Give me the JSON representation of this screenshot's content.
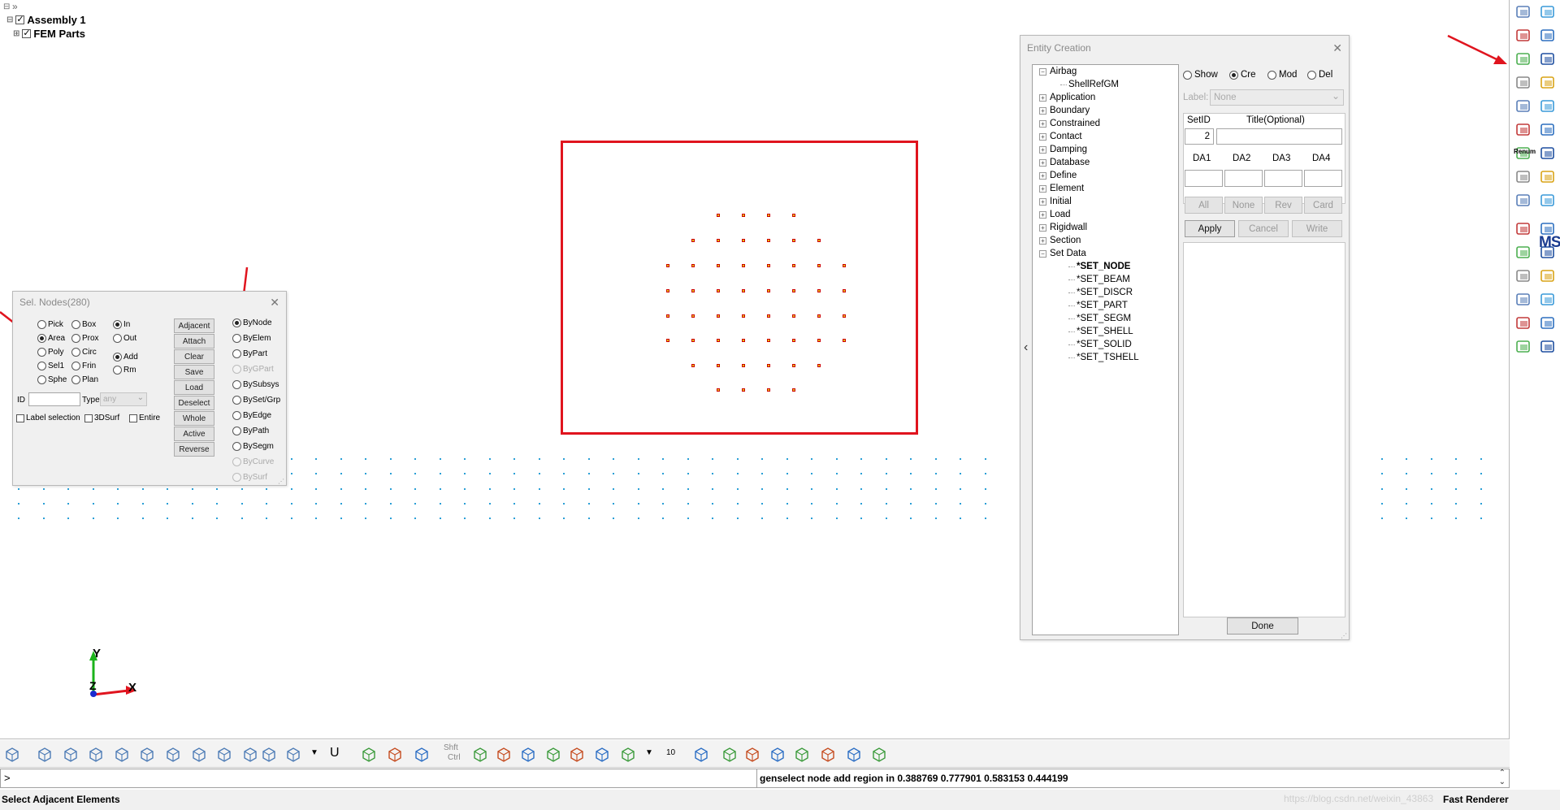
{
  "model_tree": {
    "root_label": "Assembly 1",
    "child_label": "FEM Parts",
    "collapse_glyph": "»"
  },
  "axes": {
    "y_label": "Y",
    "x_label": "X",
    "z_label": "Z"
  },
  "sel_nodes": {
    "title": "Sel. Nodes(280)",
    "pick_modes": [
      {
        "label": "Pick",
        "selected": false
      },
      {
        "label": "Box",
        "selected": false
      },
      {
        "label": "Area",
        "selected": true
      },
      {
        "label": "Prox",
        "selected": false
      },
      {
        "label": "Poly",
        "selected": false
      },
      {
        "label": "Circ",
        "selected": false
      },
      {
        "label": "Sel1",
        "selected": false
      },
      {
        "label": "Frin",
        "selected": false
      },
      {
        "label": "Sphe",
        "selected": false
      },
      {
        "label": "Plan",
        "selected": false
      }
    ],
    "in_label": "In",
    "out_label": "Out",
    "add_label": "Add",
    "rm_label": "Rm",
    "id_label": "ID",
    "type_label": "Type",
    "type_value": "any",
    "label_selection": "Label selection",
    "surf3d": "3DSurf",
    "entire": "Entire",
    "buttons": [
      "Adjacent",
      "Attach",
      "Clear",
      "Save",
      "Load",
      "Deselect",
      "Whole",
      "Active",
      "Reverse"
    ],
    "by_options": [
      {
        "label": "ByNode",
        "selected": true,
        "disabled": false
      },
      {
        "label": "ByElem",
        "selected": false,
        "disabled": false
      },
      {
        "label": "ByPart",
        "selected": false,
        "disabled": false
      },
      {
        "label": "ByGPart",
        "selected": false,
        "disabled": true
      },
      {
        "label": "BySubsys",
        "selected": false,
        "disabled": false
      },
      {
        "label": "BySet/Grp",
        "selected": false,
        "disabled": false
      },
      {
        "label": "ByEdge",
        "selected": false,
        "disabled": false
      },
      {
        "label": "ByPath",
        "selected": false,
        "disabled": false
      },
      {
        "label": "BySegm",
        "selected": false,
        "disabled": false
      },
      {
        "label": "ByCurve",
        "selected": false,
        "disabled": true
      },
      {
        "label": "BySurf",
        "selected": false,
        "disabled": true
      }
    ]
  },
  "entity_creation": {
    "title": "Entity Creation",
    "tree": [
      {
        "label": "Airbag",
        "expanded": true,
        "level": 0
      },
      {
        "label": "ShellRefGM",
        "level": 1
      },
      {
        "label": "Application",
        "level": 0
      },
      {
        "label": "Boundary",
        "level": 0
      },
      {
        "label": "Constrained",
        "level": 0
      },
      {
        "label": "Contact",
        "level": 0
      },
      {
        "label": "Damping",
        "level": 0
      },
      {
        "label": "Database",
        "level": 0
      },
      {
        "label": "Define",
        "level": 0
      },
      {
        "label": "Element",
        "level": 0
      },
      {
        "label": "Initial",
        "level": 0
      },
      {
        "label": "Load",
        "level": 0
      },
      {
        "label": "Rigidwall",
        "level": 0
      },
      {
        "label": "Section",
        "level": 0
      },
      {
        "label": "Set Data",
        "expanded": true,
        "level": 0
      },
      {
        "label": "*SET_NODE",
        "level": 2,
        "bold": true
      },
      {
        "label": "*SET_BEAM",
        "level": 2
      },
      {
        "label": "*SET_DISCR",
        "level": 2
      },
      {
        "label": "*SET_PART",
        "level": 2
      },
      {
        "label": "*SET_SEGM",
        "level": 2
      },
      {
        "label": "*SET_SHELL",
        "level": 2
      },
      {
        "label": "*SET_SOLID",
        "level": 2
      },
      {
        "label": "*SET_TSHELL",
        "level": 2
      }
    ],
    "modes": [
      {
        "label": "Show",
        "selected": false
      },
      {
        "label": "Cre",
        "selected": true
      },
      {
        "label": "Mod",
        "selected": false
      },
      {
        "label": "Del",
        "selected": false
      }
    ],
    "label_caption": "Label:",
    "label_value": "None",
    "setid_label": "SetID",
    "title_label": "Title(Optional)",
    "setid_value": "2",
    "da_labels": [
      "DA1",
      "DA2",
      "DA3",
      "DA4"
    ],
    "row_buttons": [
      "All",
      "None",
      "Rev",
      "Card"
    ],
    "action_buttons": [
      "Apply",
      "Cancel",
      "Write"
    ],
    "done_label": "Done",
    "collapse_arrow": "‹"
  },
  "bottom_toolbar": {
    "shft_label": "Shft",
    "ctrl_label": "Ctrl",
    "count_label": "10",
    "u_label": "U"
  },
  "command": {
    "prompt": ">",
    "history_text": "genselect node add region in 0.388769 0.777901 0.583153 0.444199"
  },
  "status": {
    "message": "Select Adjacent Elements",
    "watermark": "https://blog.csdn.net/weixin_43863",
    "renderer": "Fast Renderer"
  },
  "right_toolbar": {
    "renum_label": "Renum",
    "ms_label": "MS",
    "icons": [
      "gears-icon",
      "import-icon",
      "copy-icon",
      "curve-icon",
      "entity-icon",
      "plane-icon",
      "settings-icon",
      "solid-icon",
      "check-icon",
      "box-icon",
      "renum-icon",
      "mesh-icon",
      "layers-icon",
      "grid-icon",
      "shell-icon",
      "part-icon",
      "gear-small-icon",
      "ms-icon",
      "page-icon",
      "tools-icon",
      "window-icon",
      "color-icon",
      "cube-icon",
      "comment-icon",
      "table-icon",
      "explosion-icon",
      "bulb-icon",
      "tree-icon",
      "graph-icon",
      "cross-icon"
    ]
  },
  "colors": {
    "accent_red": "#e0141e",
    "node_yellow": "#e8c400",
    "bg_node_blue": "#2a9fd6"
  }
}
